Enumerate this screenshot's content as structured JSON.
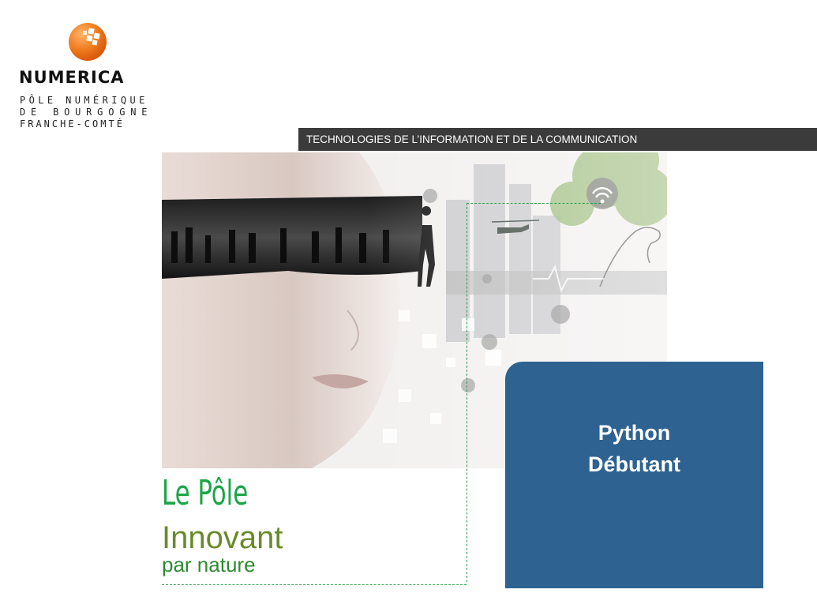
{
  "logo": {
    "name": "NUMERICA",
    "subtitle_lines": [
      "PÔLE NUMÉRIQUE",
      "DE BOURGOGNE",
      "FRANCHE-COMTÉ"
    ]
  },
  "banner": {
    "text": "TECHNOLOGIES DE L’INFORMATION ET DE LA COMMUNICATION"
  },
  "hero": {
    "image": "face-with-visor-cityscape-illustration"
  },
  "tagline": {
    "line1": "Le Pôle",
    "line2": "Innovant",
    "line3": "par nature"
  },
  "course": {
    "line1": "Python",
    "line2": "Débutant"
  },
  "colors": {
    "banner_bg": "#3b3b3b",
    "card_bg": "#2d6291",
    "tag_green": "#1aa648",
    "tag_olive": "#6a8a2a",
    "logo_orange": "#f07b1e"
  }
}
